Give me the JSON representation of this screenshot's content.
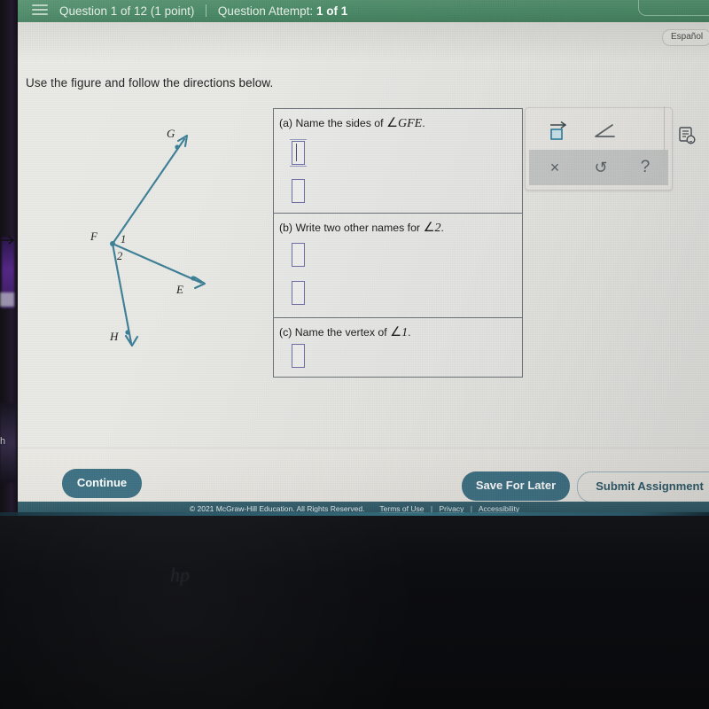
{
  "header": {
    "menu_icon": "hamburger-menu-icon",
    "question_label": "Question 1 of 12 (1 point)",
    "attempt_label_prefix": "Question Attempt:",
    "attempt_value": "1 of 1",
    "green": "#4a8a67"
  },
  "subheader": {
    "espanol_label": "Español"
  },
  "prompt": {
    "text": "Use the figure and follow the directions below."
  },
  "figure": {
    "stroke_color": "#3b7f96",
    "label_F": "F",
    "label_G": "G",
    "label_E": "E",
    "label_H": "H",
    "label_angle_1": "1",
    "label_angle_2": "2"
  },
  "answers": {
    "rows": [
      {
        "id": "a",
        "label_prefix": "(a) Name the sides of",
        "angle_symbol": "∠",
        "label_math": "GFE",
        "label_suffix": ".",
        "inputs": [
          {
            "name": "answer-a-1",
            "value": "",
            "active": true
          },
          {
            "name": "answer-a-2",
            "value": "",
            "active": false
          }
        ]
      },
      {
        "id": "b",
        "label_prefix": "(b) Write two other names for",
        "angle_symbol": "∠",
        "label_math": "2",
        "label_suffix": ".",
        "inputs": [
          {
            "name": "answer-b-1",
            "value": "",
            "active": false
          },
          {
            "name": "answer-b-2",
            "value": "",
            "active": false
          }
        ]
      },
      {
        "id": "c",
        "label_prefix": "(c) Name the vertex of",
        "angle_symbol": "∠",
        "label_math": "1",
        "label_suffix": ".",
        "inputs": [
          {
            "name": "answer-c-1",
            "value": "",
            "active": false
          }
        ]
      }
    ]
  },
  "palette": {
    "ray_icon": "ray-vector-icon",
    "angle_icon": "angle-icon",
    "clear_label": "×",
    "undo_label": "↺",
    "help_label": "?",
    "explain_icon": "explanation-lightbulb-icon"
  },
  "actions": {
    "continue_label": "Continue",
    "save_label": "Save For Later",
    "submit_label": "Submit Assignment",
    "primary_color": "#3f7285"
  },
  "footer": {
    "copyright": "© 2021 McGraw-Hill Education. All Rights Reserved.",
    "terms_label": "Terms of Use",
    "privacy_label": "Privacy",
    "accessibility_label": "Accessibility",
    "separator": "|"
  },
  "device": {
    "brand_mark": "hp"
  }
}
